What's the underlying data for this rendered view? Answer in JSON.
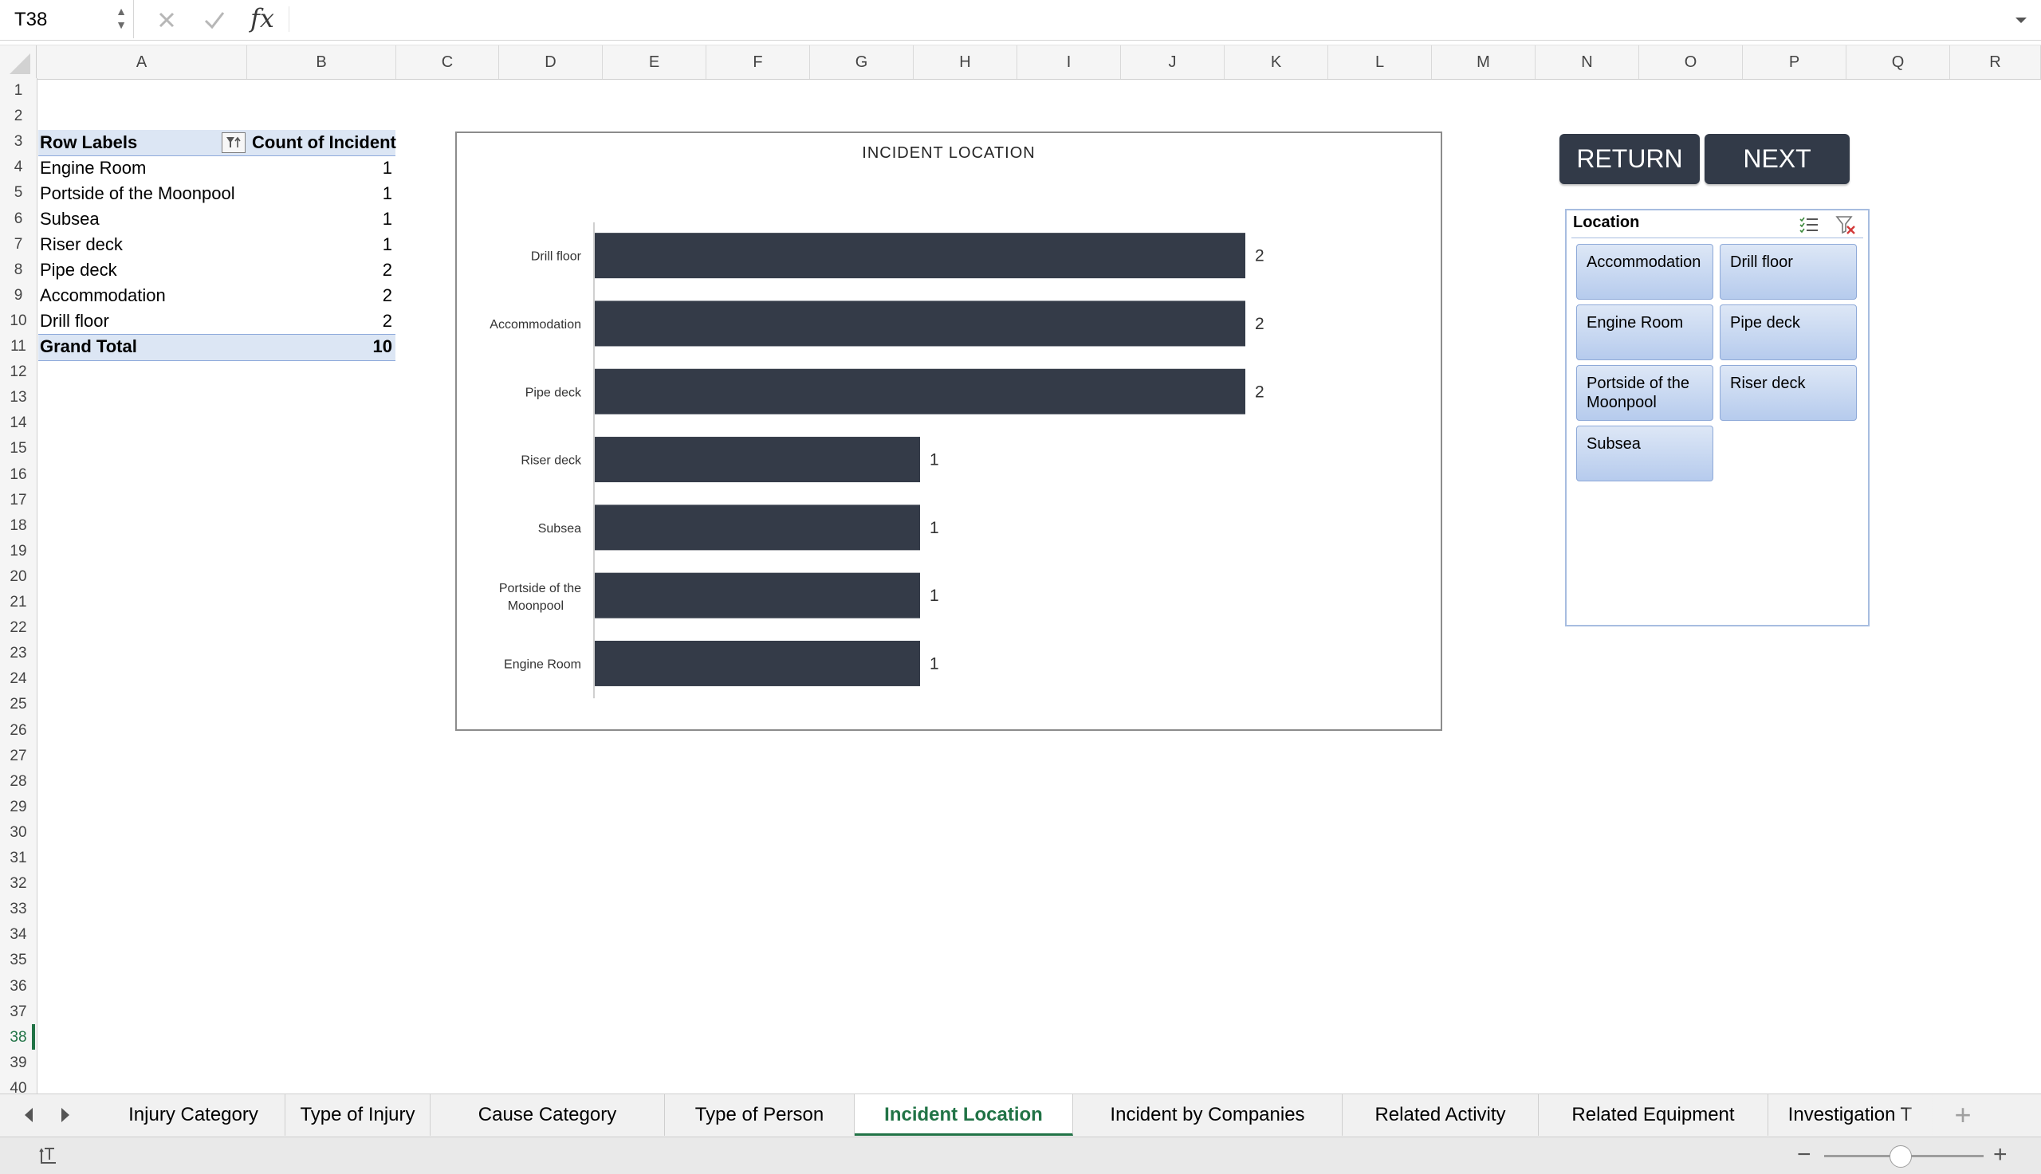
{
  "formula_bar": {
    "name_box": "T38",
    "fx": "fx",
    "formula": ""
  },
  "columns": [
    "A",
    "B",
    "C",
    "D",
    "E",
    "F",
    "G",
    "H",
    "I",
    "J",
    "K",
    "L",
    "M",
    "N",
    "O",
    "P",
    "Q",
    "R"
  ],
  "rows": [
    "1",
    "2",
    "3",
    "4",
    "5",
    "6",
    "7",
    "8",
    "9",
    "10",
    "11",
    "12",
    "13",
    "14",
    "15",
    "16",
    "17",
    "18",
    "19",
    "20",
    "21",
    "22",
    "23",
    "24",
    "25",
    "26",
    "27",
    "28",
    "29",
    "30",
    "31",
    "32",
    "33",
    "34",
    "35",
    "36",
    "37",
    "38",
    "39",
    "40"
  ],
  "active_row": "38",
  "pivot": {
    "header_label": "Row Labels",
    "header_value": "Count of Incident",
    "rows": [
      {
        "label": "Engine Room",
        "value": "1"
      },
      {
        "label": "Portside of the Moonpool",
        "value": "1"
      },
      {
        "label": "Subsea",
        "value": "1"
      },
      {
        "label": "Riser deck",
        "value": "1"
      },
      {
        "label": "Pipe deck",
        "value": "2"
      },
      {
        "label": "Accommodation",
        "value": "2"
      },
      {
        "label": "Drill floor",
        "value": "2"
      }
    ],
    "total_label": "Grand Total",
    "total_value": "10"
  },
  "chart_data": {
    "type": "bar",
    "orientation": "horizontal",
    "title": "INCIDENT LOCATION",
    "categories": [
      "Drill floor",
      "Accommodation",
      "Pipe deck",
      "Riser deck",
      "Subsea",
      "Portside of the Moonpool",
      "Engine Room"
    ],
    "values": [
      2,
      2,
      2,
      1,
      1,
      1,
      1
    ],
    "xlim": [
      0,
      2
    ],
    "bar_color": "#343b48",
    "data_labels": true,
    "grid": false,
    "legend": "none"
  },
  "buttons": {
    "return": "RETURN",
    "next": "NEXT"
  },
  "slicer": {
    "title": "Location",
    "items": [
      "Accommodation",
      "Drill floor",
      "Engine Room",
      "Pipe deck",
      "Portside of the Moonpool",
      "Riser deck",
      "Subsea"
    ],
    "icons": [
      "multi-select-icon",
      "clear-filter-icon"
    ]
  },
  "sheet_tabs": [
    "Injury Category",
    "Type of Injury",
    "Cause Category",
    "Type of Person",
    "Incident Location",
    "Incident by Companies",
    "Related Activity",
    "Related Equipment",
    "Investigation T"
  ],
  "active_tab": "Incident Location",
  "accent_color": "#217346"
}
